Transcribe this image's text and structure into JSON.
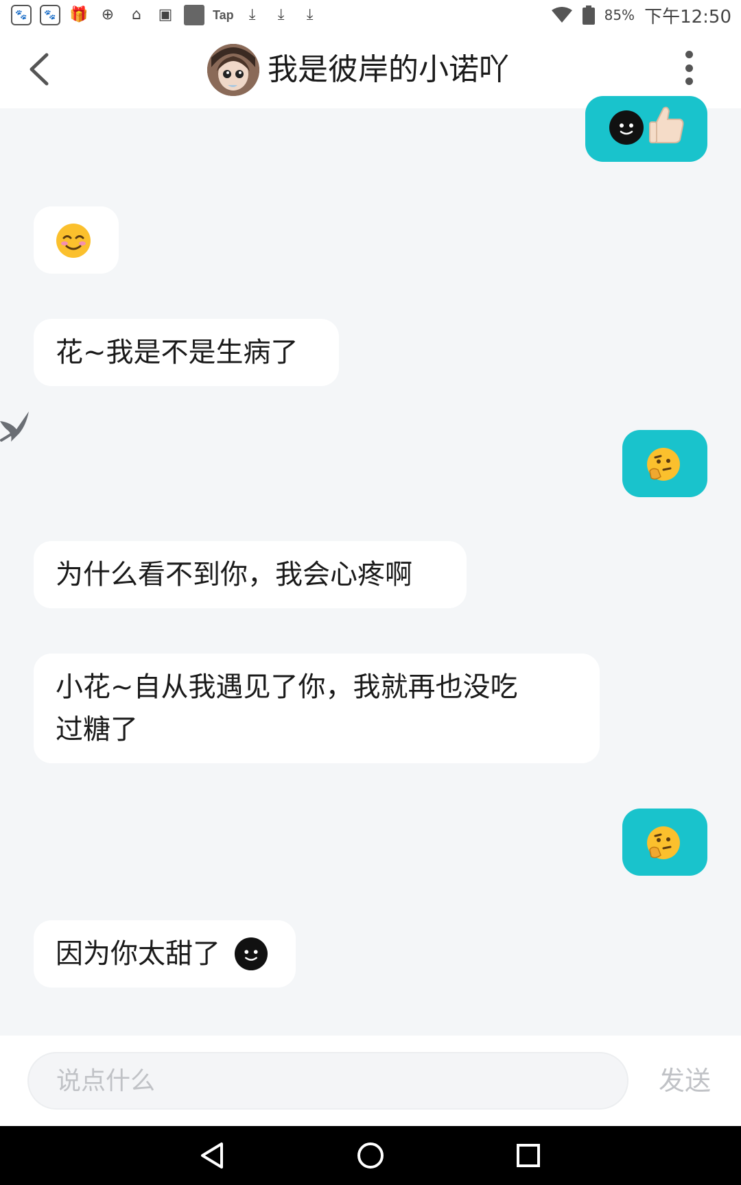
{
  "status_bar": {
    "tap_label": "Tap",
    "battery_percent": "85%",
    "time": "下午12:50"
  },
  "header": {
    "title": "我是彼岸的小诺吖"
  },
  "messages": [
    {
      "side": "right",
      "text": "",
      "emoji": [
        "black-smile-face",
        "thumbs-up"
      ]
    },
    {
      "side": "left",
      "text": "",
      "emoji": [
        "smiling-face"
      ]
    },
    {
      "side": "left",
      "text": "花~我是不是生病了"
    },
    {
      "side": "right",
      "text": "",
      "emoji": [
        "thinking-face"
      ]
    },
    {
      "side": "left",
      "text": "为什么看不到你，我会心疼啊"
    },
    {
      "side": "left",
      "text": "小花~自从我遇见了你，我就再也没吃\n过糖了"
    },
    {
      "side": "right",
      "text": "",
      "emoji": [
        "thinking-face"
      ]
    },
    {
      "side": "left",
      "text": "因为你太甜了",
      "emoji": [
        "black-smile-face"
      ]
    }
  ],
  "input": {
    "placeholder": "说点什么",
    "value": ""
  },
  "send_label": "发送",
  "colors": {
    "accent": "#19c3cc",
    "background": "#f4f6f8",
    "bubble_left": "#ffffff"
  }
}
